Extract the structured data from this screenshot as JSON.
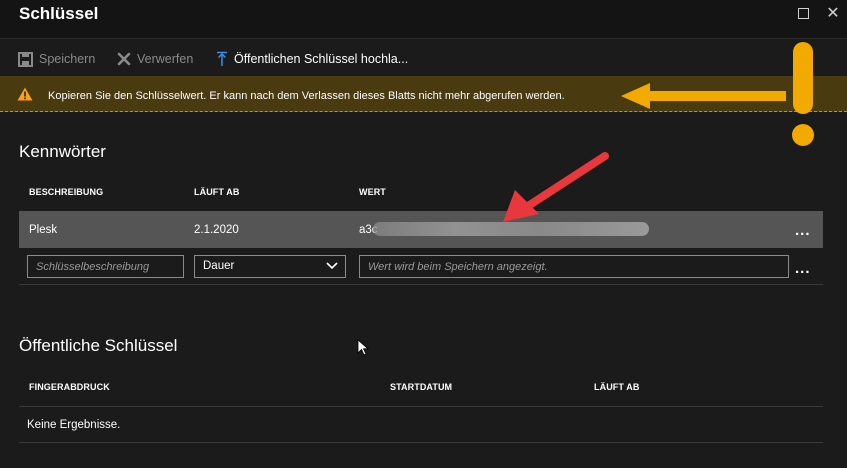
{
  "window": {
    "title": "Schlüssel",
    "maximize_icon": "maximize-icon",
    "close_icon": "close-icon",
    "close_glyph": "✕"
  },
  "toolbar": {
    "save_label": "Speichern",
    "discard_label": "Verwerfen",
    "upload_label": "Öffentlichen Schlüssel hochla..."
  },
  "banner": {
    "text": "Kopieren Sie den Schlüsselwert. Er kann nach dem Verlassen dieses Blatts nicht mehr abgerufen werden.",
    "color": "#4a3a10"
  },
  "passwords": {
    "title": "Kennwörter",
    "columns": [
      "BESCHREIBUNG",
      "LÄUFT AB",
      "WERT"
    ],
    "rows": [
      {
        "description": "Plesk",
        "expires": "2.1.2020",
        "value_visible": "a3c"
      }
    ],
    "new_row": {
      "description_placeholder": "Schlüsselbeschreibung",
      "duration_selected": "Dauer",
      "value_placeholder": "Wert wird beim Speichern angezeigt."
    },
    "more_glyph": "..."
  },
  "public_keys": {
    "title": "Öffentliche Schlüssel",
    "columns": [
      "FINGERABDRUCK",
      "STARTDATUM",
      "LÄUFT AB"
    ],
    "empty_text": "Keine Ergebnisse."
  },
  "colors": {
    "accent_annotation": "#f2a900",
    "arrow_red": "#e8383d",
    "selected_row": "#555555",
    "background": "#1b1b1b"
  }
}
